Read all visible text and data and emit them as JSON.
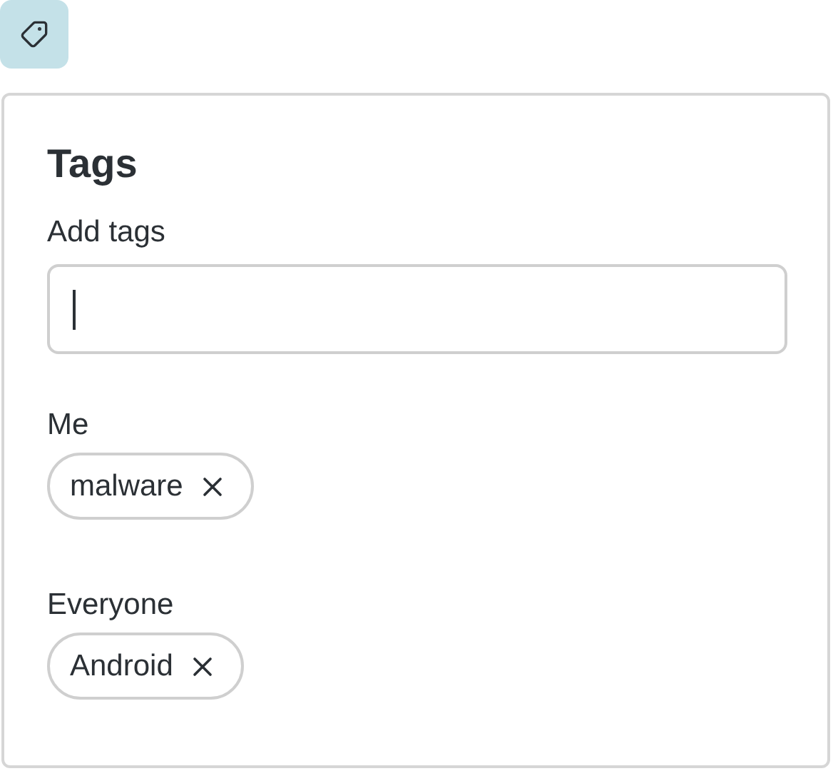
{
  "panel": {
    "title": "Tags",
    "field": {
      "label": "Add tags",
      "focused": true
    },
    "groups": [
      {
        "label": "Me",
        "tags": [
          {
            "label": "malware"
          }
        ]
      },
      {
        "label": "Everyone",
        "tags": [
          {
            "label": "Android"
          }
        ]
      }
    ]
  }
}
